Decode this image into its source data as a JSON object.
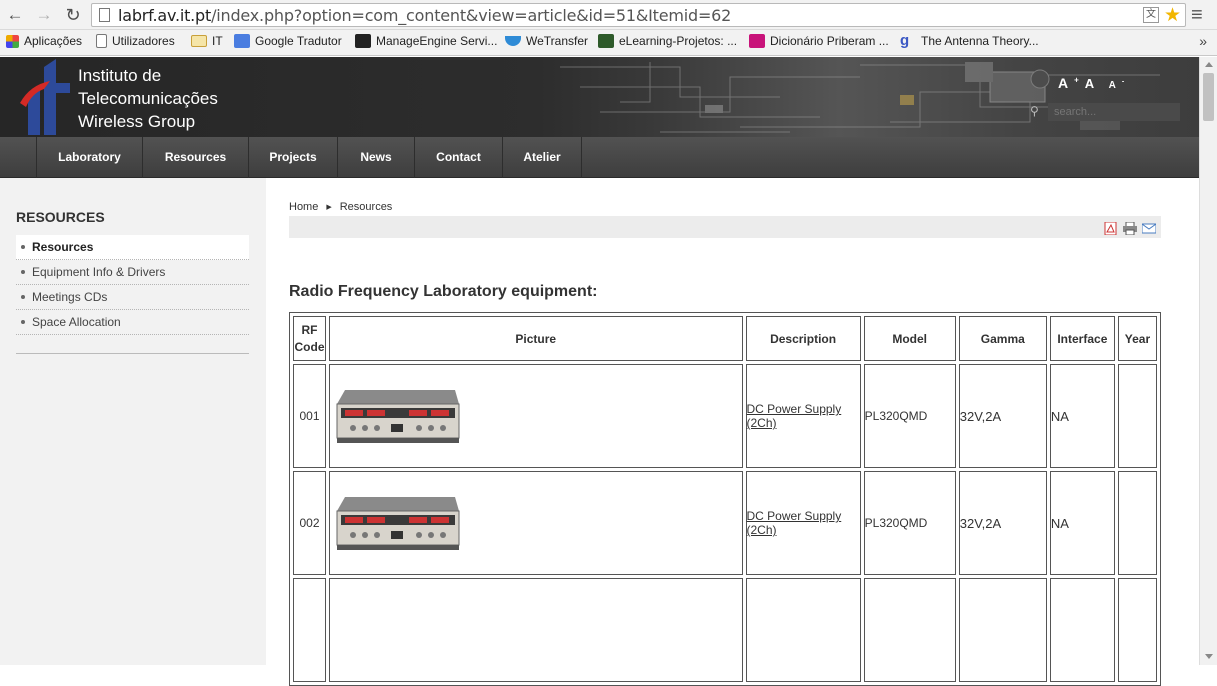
{
  "browser": {
    "url_host": "labrf.av.it.pt",
    "url_path": "/index.php?option=com_content&view=article&id=51&Itemid=62",
    "bookmarks": [
      {
        "label": "Aplicações",
        "icon": "apps-grid-icon"
      },
      {
        "label": "Utilizadores",
        "icon": "page-icon"
      },
      {
        "label": "IT",
        "icon": "folder-icon"
      },
      {
        "label": "Google Tradutor",
        "icon": "translate-icon"
      },
      {
        "label": "ManageEngine Servi...",
        "icon": "manageengine-icon"
      },
      {
        "label": "WeTransfer",
        "icon": "wetransfer-icon"
      },
      {
        "label": "eLearning-Projetos: ...",
        "icon": "elearning-icon"
      },
      {
        "label": "Dicionário Priberam ...",
        "icon": "priberam-icon"
      },
      {
        "label": "The Antenna Theory...",
        "icon": "antenna-icon"
      }
    ],
    "more": "»"
  },
  "site": {
    "name_line1": "Instituto de",
    "name_line2": "Telecomunicações",
    "name_line3": "Wireless Group",
    "font_controls": "A+ A A-",
    "search_placeholder": "search...",
    "nav": [
      "Laboratory",
      "Resources",
      "Projects",
      "News",
      "Contact",
      "Atelier"
    ]
  },
  "sidebar": {
    "title": "RESOURCES",
    "items": [
      "Resources",
      "Equipment Info & Drivers",
      "Meetings CDs",
      "Space Allocation"
    ]
  },
  "content": {
    "breadcrumb": [
      "Home",
      "Resources"
    ],
    "heading": "Radio Frequency Laboratory equipment:",
    "columns": [
      "RF Code",
      "Picture",
      "Description",
      "Model",
      "Gamma",
      "Interface",
      "Year"
    ],
    "rows": [
      {
        "code": "001",
        "picture": "dc-power-supply-photo",
        "description": "DC Power Supply (2Ch)",
        "model": "PL320QMD",
        "gamma": "32V,2A",
        "interface": "NA",
        "year": ""
      },
      {
        "code": "002",
        "picture": "dc-power-supply-photo",
        "description": "DC Power Supply (2Ch)",
        "model": "PL320QMD",
        "gamma": "32V,2A",
        "interface": "NA",
        "year": ""
      },
      {
        "code": "",
        "picture": "",
        "description": "",
        "model": "",
        "gamma": "",
        "interface": "",
        "year": ""
      }
    ]
  },
  "colors": {
    "header_bg": "#2d2d2d",
    "nav_bg": "#474747",
    "sidebar_bg": "#f2f2f2"
  }
}
